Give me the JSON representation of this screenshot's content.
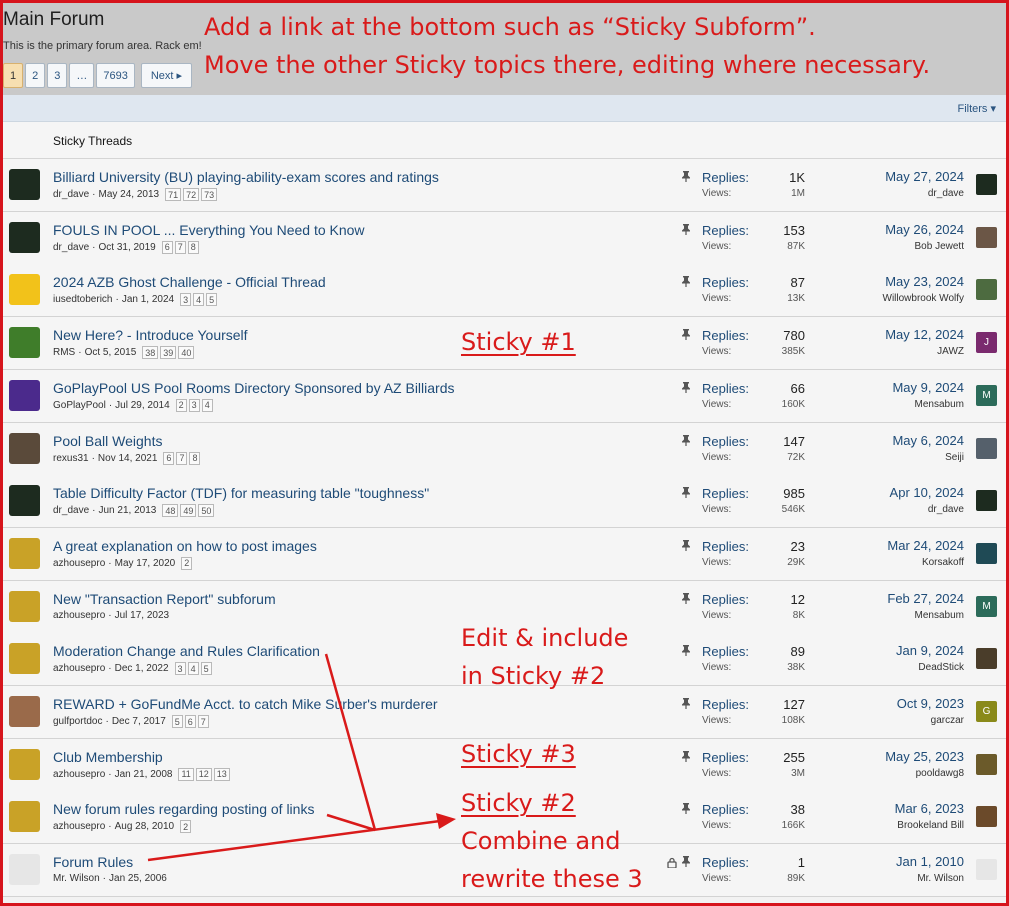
{
  "forum": {
    "title": "Main Forum",
    "description": "This is the primary forum area. Rack em!",
    "pager": {
      "p1": "1",
      "p2": "2",
      "p3": "3",
      "ellipsis": "…",
      "last": "7693",
      "next": "Next ▸"
    },
    "filters": "Filters ▾",
    "section_title": "Sticky Threads"
  },
  "labels": {
    "replies": "Replies:",
    "views": "Views:"
  },
  "threads": [
    {
      "title": "Billiard University (BU) playing-ability-exam scores and ratings",
      "author": "dr_dave",
      "date": "May 24, 2013",
      "pages": [
        "71",
        "72",
        "73"
      ],
      "replies": "1K",
      "views": "1M",
      "last_date": "May 27, 2024",
      "last_user": "dr_dave",
      "avatar_color": "#1d2b1f",
      "last_avatar_color": "#1d2b1f",
      "last_avatar_text": ""
    },
    {
      "title": "FOULS IN POOL ... Everything You Need to Know",
      "author": "dr_dave",
      "date": "Oct 31, 2019",
      "pages": [
        "6",
        "7",
        "8"
      ],
      "replies": "153",
      "views": "87K",
      "last_date": "May 26, 2024",
      "last_user": "Bob Jewett",
      "avatar_color": "#1d2b1f",
      "last_avatar_color": "#6b5646",
      "last_avatar_text": ""
    },
    {
      "title": "2024 AZB Ghost Challenge - Official Thread",
      "author": "iusedtoberich",
      "date": "Jan 1, 2024",
      "pages": [
        "3",
        "4",
        "5"
      ],
      "replies": "87",
      "views": "13K",
      "last_date": "May 23, 2024",
      "last_user": "Willowbrook Wolfy",
      "avatar_color": "#f2c21a",
      "last_avatar_color": "#4d6b40",
      "last_avatar_text": ""
    },
    {
      "title": "New Here? - Introduce Yourself",
      "author": "RMS",
      "date": "Oct 5, 2015",
      "pages": [
        "38",
        "39",
        "40"
      ],
      "replies": "780",
      "views": "385K",
      "last_date": "May 12, 2024",
      "last_user": "JAWZ",
      "avatar_color": "#3f7d2a",
      "last_avatar_color": "#7a2a6e",
      "last_avatar_text": "J"
    },
    {
      "title": "GoPlayPool US Pool Rooms Directory Sponsored by AZ Billiards",
      "author": "GoPlayPool",
      "date": "Jul 29, 2014",
      "pages": [
        "2",
        "3",
        "4"
      ],
      "replies": "66",
      "views": "160K",
      "last_date": "May 9, 2024",
      "last_user": "Mensabum",
      "avatar_color": "#4b2a8c",
      "last_avatar_color": "#2c6b5a",
      "last_avatar_text": "M"
    },
    {
      "title": "Pool Ball Weights",
      "author": "rexus31",
      "date": "Nov 14, 2021",
      "pages": [
        "6",
        "7",
        "8"
      ],
      "replies": "147",
      "views": "72K",
      "last_date": "May 6, 2024",
      "last_user": "Seiji",
      "avatar_color": "#5a4a3a",
      "last_avatar_color": "#55606b",
      "last_avatar_text": ""
    },
    {
      "title": "Table Difficulty Factor (TDF) for measuring table \"toughness\"",
      "author": "dr_dave",
      "date": "Jun 21, 2013",
      "pages": [
        "48",
        "49",
        "50"
      ],
      "replies": "985",
      "views": "546K",
      "last_date": "Apr 10, 2024",
      "last_user": "dr_dave",
      "avatar_color": "#1d2b1f",
      "last_avatar_color": "#1d2b1f",
      "last_avatar_text": ""
    },
    {
      "title": "A great explanation on how to post images",
      "author": "azhousepro",
      "date": "May 17, 2020",
      "pages": [
        "2"
      ],
      "replies": "23",
      "views": "29K",
      "last_date": "Mar 24, 2024",
      "last_user": "Korsakoff",
      "avatar_color": "#c9a227",
      "last_avatar_color": "#1f4a55",
      "last_avatar_text": ""
    },
    {
      "title": "New \"Transaction Report\" subforum",
      "author": "azhousepro",
      "date": "Jul 17, 2023",
      "pages": [],
      "replies": "12",
      "views": "8K",
      "last_date": "Feb 27, 2024",
      "last_user": "Mensabum",
      "avatar_color": "#c9a227",
      "last_avatar_color": "#2c6b5a",
      "last_avatar_text": "M"
    },
    {
      "title": "Moderation Change and Rules Clarification",
      "author": "azhousepro",
      "date": "Dec 1, 2022",
      "pages": [
        "3",
        "4",
        "5"
      ],
      "replies": "89",
      "views": "38K",
      "last_date": "Jan 9, 2024",
      "last_user": "DeadStick",
      "avatar_color": "#c9a227",
      "last_avatar_color": "#4a3d2a",
      "last_avatar_text": ""
    },
    {
      "title": "REWARD + GoFundMe Acct. to catch Mike Surber's murderer",
      "author": "gulfportdoc",
      "date": "Dec 7, 2017",
      "pages": [
        "5",
        "6",
        "7"
      ],
      "replies": "127",
      "views": "108K",
      "last_date": "Oct 9, 2023",
      "last_user": "garczar",
      "avatar_color": "#9a6a4a",
      "last_avatar_color": "#8a8a1a",
      "last_avatar_text": "G"
    },
    {
      "title": "Club Membership",
      "author": "azhousepro",
      "date": "Jan 21, 2008",
      "pages": [
        "11",
        "12",
        "13"
      ],
      "replies": "255",
      "views": "3M",
      "last_date": "May 25, 2023",
      "last_user": "pooldawg8",
      "avatar_color": "#c9a227",
      "last_avatar_color": "#6b5a2a",
      "last_avatar_text": ""
    },
    {
      "title": "New forum rules regarding posting of links",
      "author": "azhousepro",
      "date": "Aug 28, 2010",
      "pages": [
        "2"
      ],
      "replies": "38",
      "views": "166K",
      "last_date": "Mar 6, 2023",
      "last_user": "Brookeland Bill",
      "avatar_color": "#c9a227",
      "last_avatar_color": "#6b4a2a",
      "last_avatar_text": ""
    },
    {
      "title": "Forum Rules",
      "author": "Mr. Wilson",
      "date": "Jan 25, 2006",
      "pages": [],
      "replies": "1",
      "views": "89K",
      "last_date": "Jan 1, 2010",
      "last_user": "Mr. Wilson",
      "avatar_color": "#e6e6e6",
      "last_avatar_color": "#e6e6e6",
      "last_avatar_text": "",
      "locked": true
    }
  ],
  "annotations": {
    "top_line1": "Add a link at the bottom such as “Sticky Subform”.",
    "top_line2": "Move the other Sticky topics there, editing where necessary.",
    "sticky1": "Sticky #1",
    "edit_line1": "Edit & include",
    "edit_line2": "in Sticky #2",
    "sticky3": "Sticky #3",
    "sticky2": "Sticky #2",
    "combine_line1": "Combine and",
    "combine_line2": "rewrite these 3",
    "color": "#d91a1a"
  }
}
